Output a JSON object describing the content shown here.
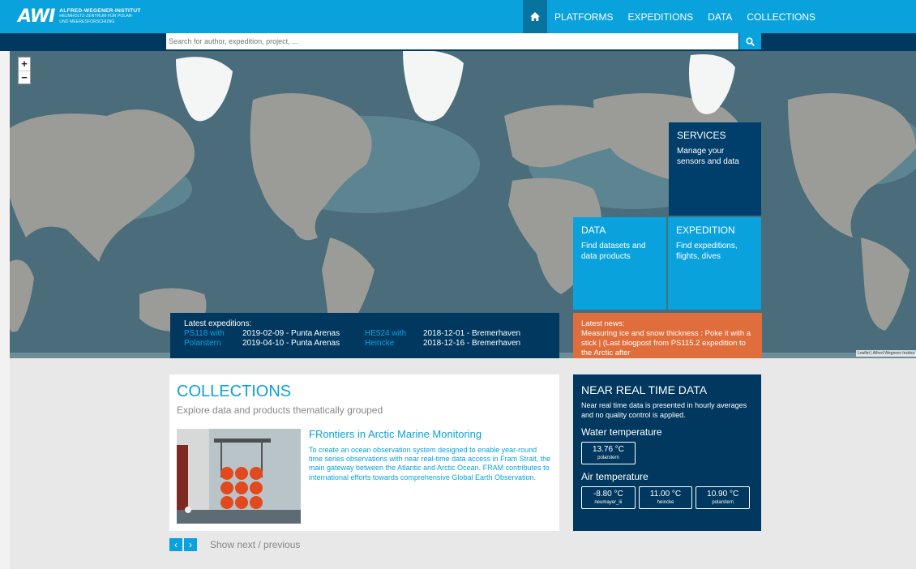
{
  "header": {
    "logo_mark": "AWI",
    "logo_line1": "ALFRED-WEGENER-INSTITUT",
    "logo_line2": "HELMHOLTZ-ZENTRUM FÜR POLAR-",
    "logo_line3": "UND MEERESFORSCHUNG",
    "nav": [
      "PLATFORMS",
      "EXPEDITIONS",
      "DATA",
      "COLLECTIONS"
    ],
    "home_icon": "home-icon"
  },
  "search": {
    "placeholder": "Search for author, expedition, project, ...",
    "icon": "search-icon"
  },
  "map": {
    "zoom_in": "+",
    "zoom_out": "−",
    "attribution": "Leaflet | Alfred-Wegener-Institut"
  },
  "tiles": {
    "services": {
      "title": "SERVICES",
      "sub": "Manage your sensors and data"
    },
    "data": {
      "title": "DATA",
      "sub": "Find datasets and data products"
    },
    "expedition": {
      "title": "EXPEDITION",
      "sub": "Find expeditions, flights, dives"
    }
  },
  "latest_expeditions": {
    "header": "Latest expeditions:",
    "items": [
      {
        "name_line1": "PS118 with",
        "name_line2": "Polarstern",
        "date1": "2019-02-09 - Punta Arenas",
        "date2": "2019-04-10 - Punta Arenas"
      },
      {
        "name_line1": "HE524 with",
        "name_line2": "Heincke",
        "date1": "2018-12-01 - Bremerhaven",
        "date2": "2018-12-16 - Bremerhaven"
      }
    ]
  },
  "latest_news": {
    "header": "Latest news:",
    "text": "Measuring ice and snow thickness : Poke it with a stick | (Last blogpost from PS115.2 expedition to the Arctic after"
  },
  "collections": {
    "title": "COLLECTIONS",
    "subtitle": "Explore data and products thematically grouped",
    "item_title": "FRontiers in Arctic Marine Monitoring",
    "item_text": "To create an ocean observation system designed to enable year-round time series observations with near real-time data access in Fram Strait, the main gateway between the Atlantic and Arctic Ocean. FRAM contributes to international efforts towards comprehensive Global Earth Observation.",
    "prev": "‹",
    "next": "›",
    "pager_label": "Show next / previous"
  },
  "near_real_time": {
    "title": "NEAR REAL TIME DATA",
    "description": "Near real time data is presented in hourly averages and no quality control is applied.",
    "water_label": "Water temperature",
    "water": [
      {
        "value": "13.76 °C",
        "station": "polarstern"
      }
    ],
    "air_label": "Air temperature",
    "air": [
      {
        "value": "-8.80 °C",
        "station": "neumayer_iii"
      },
      {
        "value": "11.00 °C",
        "station": "heincke"
      },
      {
        "value": "10.90 °C",
        "station": "polarstern"
      }
    ]
  },
  "colors": {
    "accent": "#0aa2dc",
    "navy": "#00385f",
    "orange": "#e06e3c"
  }
}
